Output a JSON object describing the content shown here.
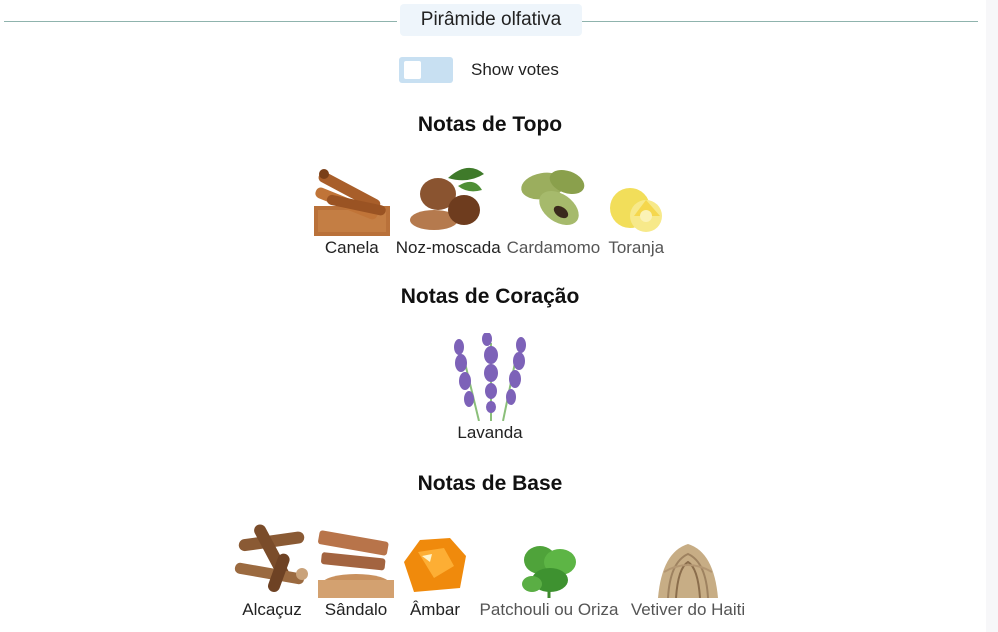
{
  "pyramid": {
    "title": "Pirâmide olfativa",
    "toggle_label": "Show votes",
    "toggle_on": false
  },
  "sections": {
    "top": {
      "title": "Notas de Topo",
      "notes": [
        {
          "label": "Canela",
          "icon": "cinnamon-icon"
        },
        {
          "label": "Noz-moscada",
          "icon": "nutmeg-icon"
        },
        {
          "label": "Cardamomo",
          "icon": "cardamom-icon"
        },
        {
          "label": "Toranja",
          "icon": "grapefruit-icon"
        }
      ]
    },
    "heart": {
      "title": "Notas de Coração",
      "notes": [
        {
          "label": "Lavanda",
          "icon": "lavender-icon"
        }
      ]
    },
    "base": {
      "title": "Notas de Base",
      "notes": [
        {
          "label": "Alcaçuz",
          "icon": "licorice-icon"
        },
        {
          "label": "Sândalo",
          "icon": "sandalwood-icon"
        },
        {
          "label": "Âmbar",
          "icon": "amber-icon"
        },
        {
          "label": "Patchouli ou Oriza",
          "icon": "patchouli-icon"
        },
        {
          "label": "Vetiver do Haiti",
          "icon": "vetiver-icon"
        }
      ]
    }
  },
  "colors": {
    "divider": "#8fb3ad",
    "title_bg": "#eef5fb",
    "toggle_bg": "#c8e0f2"
  }
}
